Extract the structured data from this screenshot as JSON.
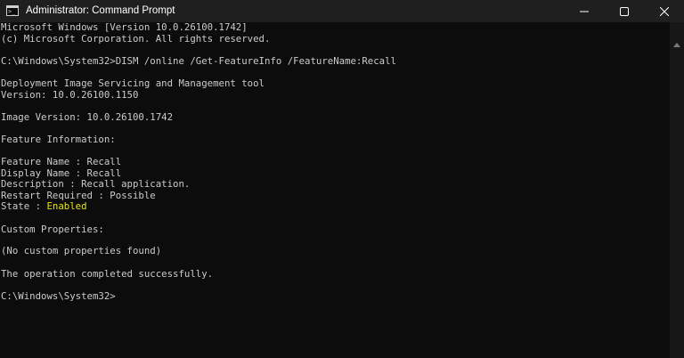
{
  "window": {
    "title": "Administrator: Command Prompt",
    "icon": "command-prompt-icon",
    "controls": [
      "minimize-icon",
      "maximize-icon",
      "close-icon"
    ]
  },
  "console": {
    "line_1": "Microsoft Windows [Version 10.0.26100.1742]",
    "line_2": "(c) Microsoft Corporation. All rights reserved.",
    "line_3": "C:\\Windows\\System32>DISM /online /Get-FeatureInfo /FeatureName:Recall",
    "line_4": "Deployment Image Servicing and Management tool",
    "line_5": "Version: 10.0.26100.1150",
    "line_6": "Image Version: 10.0.26100.1742",
    "line_7": "Feature Information:",
    "line_8": "Feature Name : Recall",
    "line_9": "Display Name : Recall",
    "line_10": "Description : Recall application.",
    "line_11": "Restart Required : Possible",
    "state_label": "State : ",
    "state_value": "Enabled",
    "line_13": "Custom Properties:",
    "line_14": "(No custom properties found)",
    "line_15": "The operation completed successfully.",
    "prompt": "C:\\Windows\\System32>"
  },
  "colors": {
    "background": "#0c0c0c",
    "text": "#cccccc",
    "state_value": "#e5e510",
    "titlebar": "#1f1f1f"
  }
}
